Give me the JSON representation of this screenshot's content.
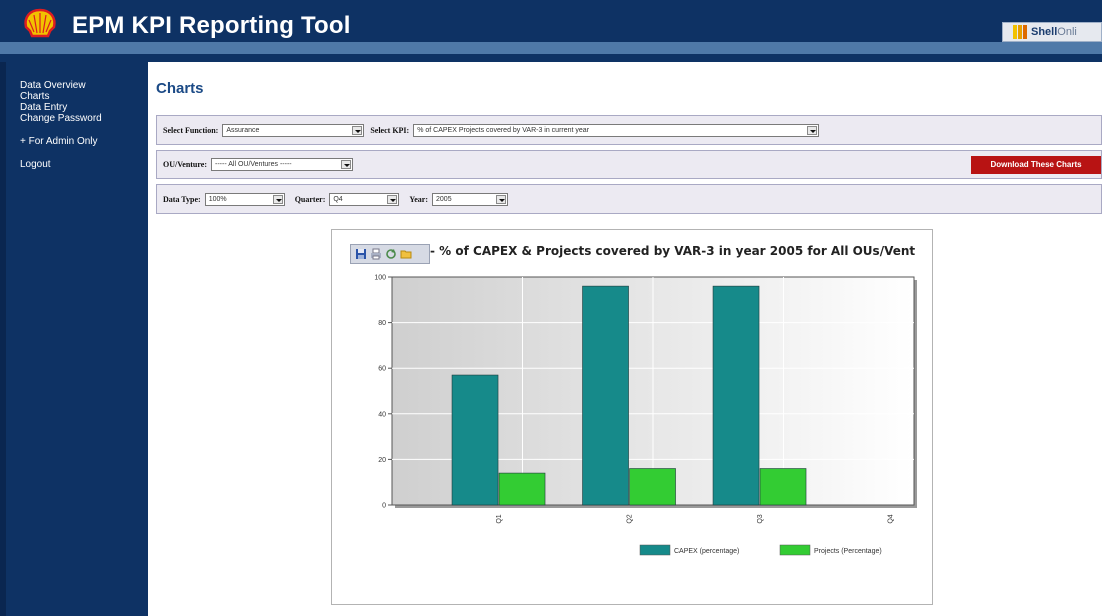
{
  "app": {
    "title": "EPM KPI Reporting Tool",
    "partner_brand": "Shell",
    "partner_brand_suffix": "Onli",
    "logo_icon": "shell-pecten-icon"
  },
  "sidebar": {
    "items": [
      {
        "label": "Data Overview"
      },
      {
        "label": "Charts"
      },
      {
        "label": "Data Entry"
      },
      {
        "label": "Change Password"
      },
      {
        "label": "+ For Admin Only"
      },
      {
        "label": "Logout"
      }
    ]
  },
  "page": {
    "title": "Charts"
  },
  "filters": {
    "function_label": "Select Function:",
    "function_value": "Assurance",
    "kpi_label": "Select KPI:",
    "kpi_value": "% of CAPEX Projects covered by VAR-3 in current year",
    "ou_label": "OU/Venture:",
    "ou_value": "----- All OU/Ventures -----",
    "download_label": "Download These Charts",
    "datatype_label": "Data Type:",
    "datatype_value": "100%",
    "quarter_label": "Quarter:",
    "quarter_value": "Q4",
    "year_label": "Year:",
    "year_value": "2005"
  },
  "colors": {
    "header": "#0e3264",
    "accent": "#1b4a86",
    "download": "#b81313",
    "series_capex": "#168a8a",
    "series_projects": "#33cc33"
  },
  "toolbar": {
    "icons": [
      "save-icon",
      "print-icon",
      "refresh-icon",
      "folder-icon"
    ]
  },
  "chart_data": {
    "type": "bar",
    "title": "% of CAPEX & Projects covered by VAR-3 in year 2005 for All OUs/Vent",
    "categories": [
      "Q1",
      "Q2",
      "Q3",
      "Q4"
    ],
    "series": [
      {
        "name": "CAPEX (percentage)",
        "values": [
          57,
          96,
          96,
          null
        ]
      },
      {
        "name": "Projects (Percentage)",
        "values": [
          14,
          16,
          16,
          null
        ]
      }
    ],
    "ylim": [
      0,
      100
    ],
    "yticks": [
      0,
      20,
      40,
      60,
      80,
      100
    ],
    "grid": true,
    "legend": "bottom"
  }
}
